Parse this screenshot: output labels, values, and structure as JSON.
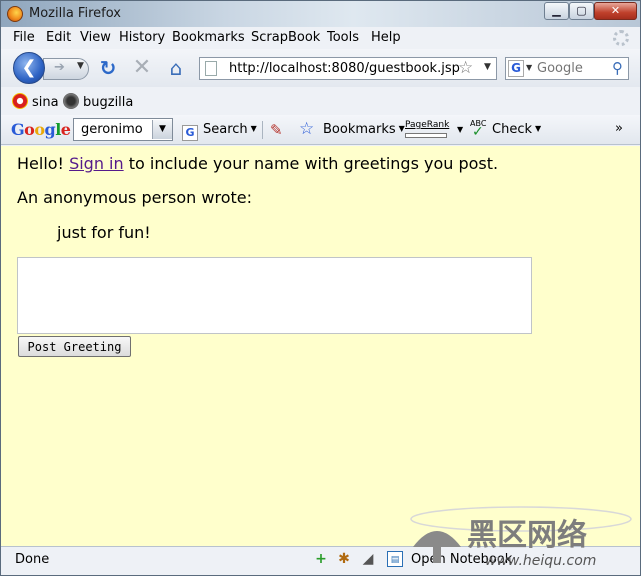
{
  "window": {
    "title": "Mozilla Firefox"
  },
  "menubar": {
    "items": [
      "File",
      "Edit",
      "View",
      "History",
      "Bookmarks",
      "ScrapBook",
      "Tools",
      "Help"
    ]
  },
  "navbar": {
    "url": "http://localhost:8080/guestbook.jsp",
    "search_placeholder": "Google"
  },
  "bookmarks_toolbar": {
    "items": [
      {
        "label": "sina",
        "icon": "sina-icon"
      },
      {
        "label": "bugzilla",
        "icon": "bugzilla-icon"
      }
    ]
  },
  "google_toolbar": {
    "logo": "Google",
    "search_value": "geronimo",
    "search_label": "Search",
    "bookmarks_label": "Bookmarks",
    "pagerank_label": "PageRank",
    "spell_abc_label": "ABC",
    "check_label": "Check"
  },
  "page": {
    "greeting_prefix": "Hello!",
    "sign_in_link": "Sign in",
    "greeting_suffix": "to include your name with greetings you post.",
    "anonymous_author": "An anonymous person wrote:",
    "greeting_message": "just for fun!",
    "textarea_value": "",
    "post_button": "Post Greeting",
    "background_color": "#ffffcc"
  },
  "statusbar": {
    "status": "Done",
    "notebook_label": "Open Notebook"
  },
  "watermark": {
    "logo_text": "黑区网络",
    "url_text": "www.heiqu.com"
  }
}
